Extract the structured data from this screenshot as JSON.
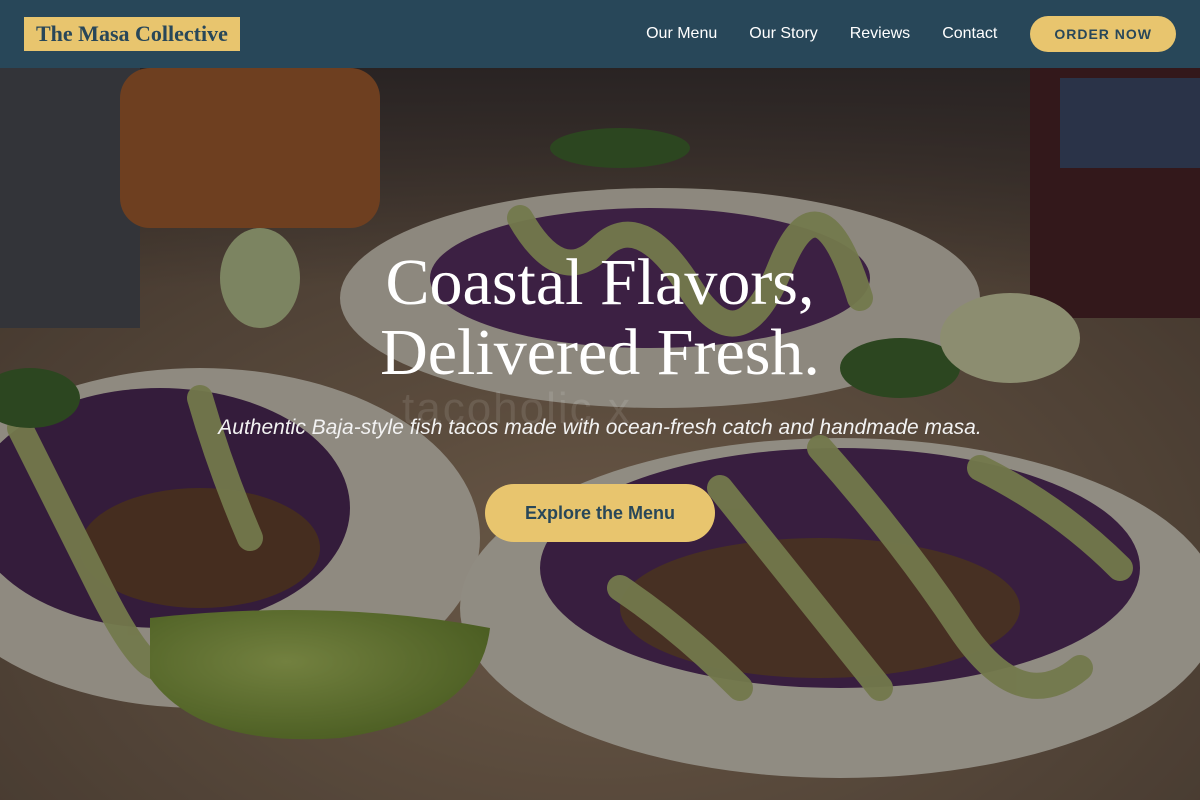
{
  "brand": {
    "name": "The Masa Collective"
  },
  "nav": {
    "links": [
      "Our Menu",
      "Our Story",
      "Reviews",
      "Contact"
    ],
    "order_label": "ORDER NOW"
  },
  "hero": {
    "headline_line1": "Coastal Flavors,",
    "headline_line2": "Delivered Fresh.",
    "subheadline": "Authentic Baja-style fish tacos made with ocean-fresh catch and handmade masa.",
    "cta_label": "Explore the Menu",
    "watermark": "tacoholic x",
    "image_subject": "fish tacos with purple cabbage, avocado crema and lime wedges"
  },
  "colors": {
    "header_bg": "#284759",
    "accent": "#e8c56e",
    "text_light": "#ffffff"
  }
}
